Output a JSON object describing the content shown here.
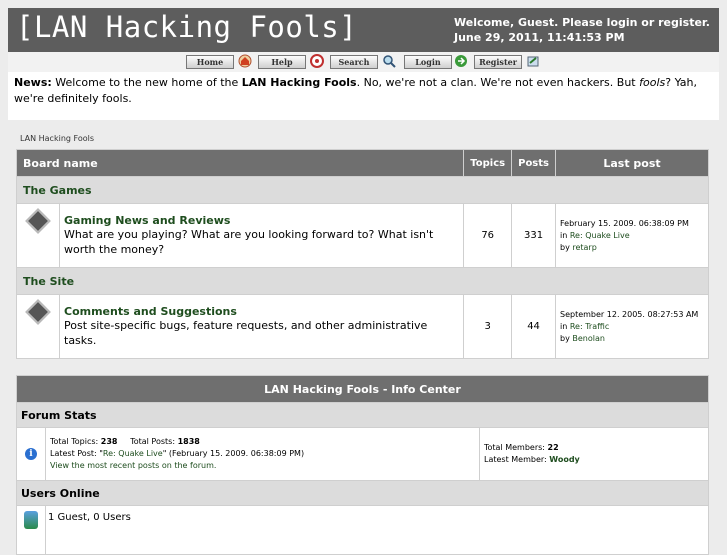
{
  "header": {
    "site_title": "[LAN Hacking Fools]",
    "welcome_line": "Welcome, Guest. Please login or register.",
    "datetime": "June 29, 2011, 11:41:53 PM"
  },
  "nav": {
    "home": "Home",
    "help": "Help",
    "search": "Search",
    "login": "Login",
    "register": "Register"
  },
  "news": {
    "label": "News:",
    "text_1": " Welcome to the new home of the ",
    "site_name": "LAN Hacking Fools",
    "text_2": ". No, we're not a clan. We're not even hackers. But ",
    "fools": "fools",
    "text_3": "? Yah, we're definitely fools."
  },
  "breadcrumb": "LAN Hacking Fools",
  "board_table": {
    "col_board": "Board name",
    "col_topics": "Topics",
    "col_posts": "Posts",
    "col_last": "Last post"
  },
  "categories": [
    {
      "name": "The Games",
      "boards": [
        {
          "title": "Gaming News and Reviews",
          "description": "What are you playing? What are you looking forward to? What isn't worth the money?",
          "topics": "76",
          "posts": "331",
          "last_date": "February 15. 2009. 06:38:09 PM",
          "in_label": "in ",
          "last_topic": "Re: Quake Live",
          "by_label": "by ",
          "last_user": "retarp"
        }
      ]
    },
    {
      "name": "The Site",
      "boards": [
        {
          "title": "Comments and Suggestions",
          "description": "Post site-specific bugs, feature requests, and other administrative tasks.",
          "topics": "3",
          "posts": "44",
          "last_date": "September 12. 2005. 08:27:53 AM",
          "in_label": "in ",
          "last_topic": "Re: Traffic",
          "by_label": "by ",
          "last_user": "Benolan"
        }
      ]
    }
  ],
  "info_center": {
    "title": "LAN Hacking Fools - Info Center",
    "forum_stats_label": "Forum Stats",
    "total_topics_label": "Total Topics: ",
    "total_topics": "238",
    "total_posts_label": "Total Posts: ",
    "total_posts": "1838",
    "latest_post_label": "Latest Post: \"",
    "latest_post_title": "Re: Quake Live",
    "latest_post_date": "\" (February 15. 2009. 06:38:09 PM)",
    "recent_posts_link": "View the most recent posts on the forum.",
    "total_members_label": "Total Members: ",
    "total_members": "22",
    "latest_member_label": "Latest Member: ",
    "latest_member": "Woody",
    "users_online_label": "Users Online",
    "users_online_text": "1 Guest, 0 Users"
  },
  "colors": {
    "header_bg": "#5d5d5d",
    "table_header_bg": "#6f6f6f",
    "category_bg": "#dcdcdc",
    "link_green": "#1e4d1e"
  },
  "icons": [
    "home-icon",
    "help-icon",
    "search-icon",
    "login-icon",
    "register-icon",
    "board-diamond-icon",
    "info-icon",
    "users-online-icon"
  ]
}
